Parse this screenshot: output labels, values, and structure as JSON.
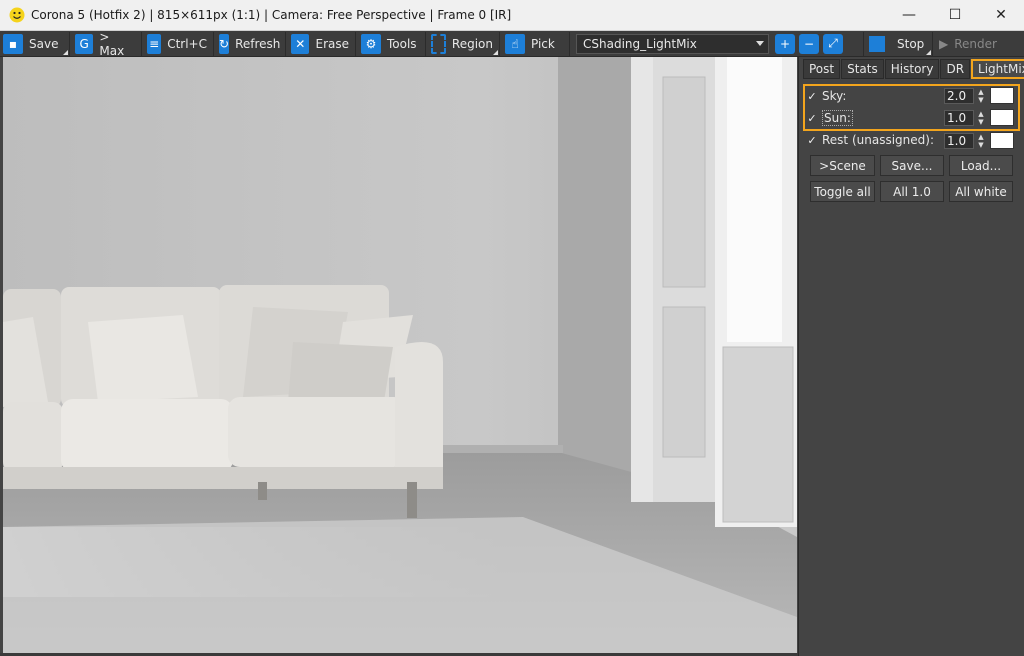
{
  "titlebar": {
    "title": "Corona 5 (Hotfix 2) | 815×611px (1:1) | Camera: Free Perspective | Frame 0 [IR]",
    "minimize": "—",
    "maximize": "☐",
    "close": "✕"
  },
  "toolbar": {
    "save": "Save",
    "to_max": "> Max",
    "copy": "Ctrl+C",
    "refresh": "Refresh",
    "erase": "Erase",
    "tools": "Tools",
    "region": "Region",
    "pick": "Pick",
    "render_elem": "CShading_LightMix",
    "stop": "Stop",
    "render": "Render"
  },
  "panel": {
    "tabs": [
      "Post",
      "Stats",
      "History",
      "DR",
      "LightMix"
    ],
    "active_tab": "LightMix",
    "lights": [
      {
        "label": "Sky:",
        "value": "2.0",
        "checked": "✓"
      },
      {
        "label": "Sun:",
        "value": "1.0",
        "checked": "✓"
      },
      {
        "label": "Rest (unassigned):",
        "value": "1.0",
        "checked": "✓"
      }
    ],
    "buttons_row1": [
      ">Scene",
      "Save...",
      "Load..."
    ],
    "buttons_row2": [
      "Toggle all",
      "All 1.0",
      "All white"
    ]
  },
  "colors": {
    "accent": "#1d7fd8",
    "highlight": "#f3a51d",
    "panel_bg": "#444444",
    "title_bg": "#f0f0f0"
  }
}
